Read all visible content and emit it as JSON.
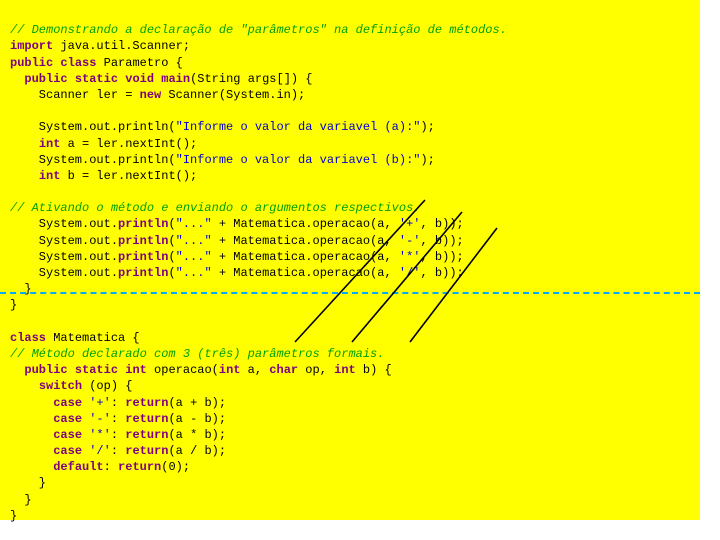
{
  "code": {
    "c1": "// Demonstrando a declaração de \"parâmetros\" na definição de métodos.",
    "l2_kw1": "import",
    "l2_rest": " java.util.Scanner;",
    "l3_kw1": "public",
    "l3_kw2": "class",
    "l3_rest": " Parametro {",
    "l4_kw1": "public",
    "l4_kw2": "static",
    "l4_kw3": "void",
    "l4_kw4": "main",
    "l4_rest": "(String args[]) {",
    "l5_a": "    Scanner ler = ",
    "l5_kw": "new",
    "l5_b": " Scanner(System.in);",
    "l7_a": "    System.out.println(",
    "l7_s": "\"Informe o valor da variavel (a):\"",
    "l7_b": ");",
    "l8_kw": "int",
    "l8_rest": " a = ler.nextInt();",
    "l9_a": "    System.out.println(",
    "l9_s": "\"Informe o valor da variavel (b):\"",
    "l9_b": ");",
    "l10_kw": "int",
    "l10_rest": " b = ler.nextInt();",
    "c2": "// Ativando o método e enviando o argumentos respectivos.",
    "p1_a": "    System.out.",
    "p_kw": "println",
    "p1_b": "(",
    "p_s": "\"...\"",
    "p1_c": " + Matematica.operacao(a, ",
    "p1_op": "'+'",
    "p1_d": ", b));",
    "p2_c": " + Matematica.operacao(a, ",
    "p2_op": "'-'",
    "p2_d": ", b));",
    "p3_c": " + Matematica.operacao(a, ",
    "p3_op": "'*'",
    "p3_d": ", b));",
    "p4_c": " + Matematica.operacao(a, ",
    "p4_op": "'/'",
    "p4_d": ", b));",
    "brace1": "  }",
    "brace2": "}",
    "l_cls_kw": "class",
    "l_cls_rest": " Matematica {",
    "c3": "// Método declarado com 3 (três) parâmetros formais.",
    "m_kw1": "public",
    "m_kw2": "static",
    "m_kw3": "int",
    "m_name": " operacao(",
    "m_kw4": "int",
    "m_p1": " a, ",
    "m_kw5": "char",
    "m_p2": " op, ",
    "m_kw6": "int",
    "m_p3": " b) {",
    "sw_kw": "switch",
    "sw_rest": " (op) {",
    "case_kw": "case",
    "ret_kw": "return",
    "c_plus": "'+'",
    "c_plus_r": "(a + b);",
    "c_minus": "'-'",
    "c_minus_r": "(a - b);",
    "c_mult": "'*'",
    "c_mult_r": "(a * b);",
    "c_div": "'/'",
    "c_div_r": "(a / b);",
    "def_kw": "default",
    "def_r": "(0);",
    "brace3": "    }",
    "brace4": "  }",
    "brace5": "}"
  }
}
